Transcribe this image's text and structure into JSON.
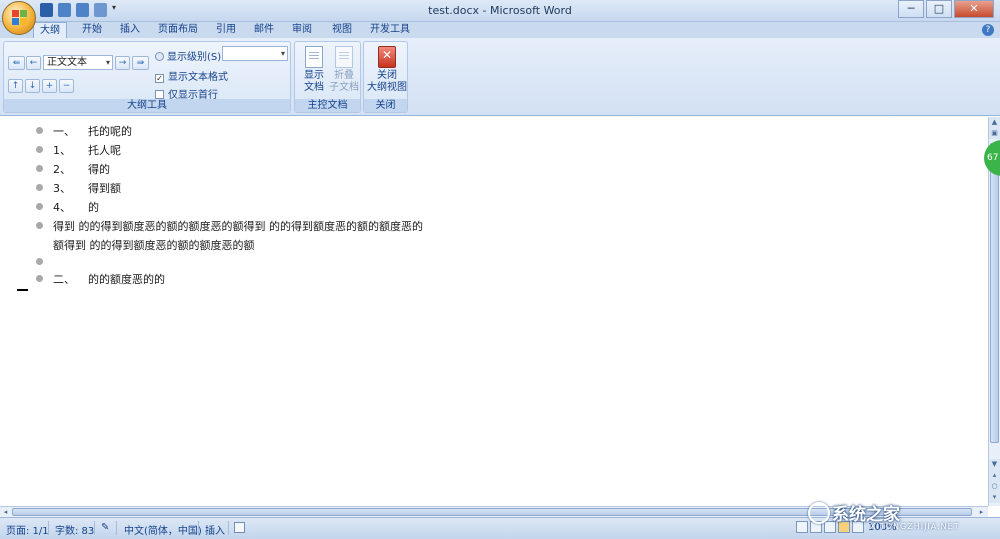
{
  "window": {
    "title": "test.docx - Microsoft Word",
    "minimize": "─",
    "maximize": "□",
    "close": "✕"
  },
  "tabs": [
    {
      "label": "大纲",
      "active": true
    },
    {
      "label": "开始"
    },
    {
      "label": "插入"
    },
    {
      "label": "页面布局"
    },
    {
      "label": "引用"
    },
    {
      "label": "邮件"
    },
    {
      "label": "审阅"
    },
    {
      "label": "视图"
    },
    {
      "label": "开发工具"
    }
  ],
  "ribbon": {
    "outline_tools": {
      "group_label": "大纲工具",
      "level_combo_value": "正文文本",
      "show_level_label": "显示级别(S):",
      "show_level_value": "",
      "show_text_format": {
        "label": "显示文本格式",
        "checked": true
      },
      "show_first_line_only": {
        "label": "仅显示首行",
        "checked": false
      }
    },
    "master_document": {
      "group_label": "主控文档",
      "show_document": "显示\n文档",
      "collapse_subdocs": "折叠\n子文档"
    },
    "close_group": {
      "group_label": "关闭",
      "close_outline_view": "关闭\n大纲视图"
    }
  },
  "document": {
    "lines": [
      {
        "num": "一、",
        "text": "托的呢的",
        "bullet": true
      },
      {
        "num": "1、",
        "text": "托人呢",
        "bullet": true
      },
      {
        "num": "2、",
        "text": "得的",
        "bullet": true
      },
      {
        "num": "3、",
        "text": "得到额",
        "bullet": true
      },
      {
        "num": "4、",
        "text": "的",
        "bullet": true
      },
      {
        "num": "",
        "text": "得到 的的得到额度恶的额的额度恶的额得到 的的得到额度恶的额的额度恶的",
        "bullet": true
      },
      {
        "num": "",
        "text": "额得到 的的得到额度恶的额的额度恶的额",
        "bullet": false
      },
      {
        "num": "",
        "text": "",
        "bullet": true
      },
      {
        "num": "二、",
        "text": "的的额度恶的的",
        "bullet": true
      }
    ]
  },
  "side_badge": "67",
  "statusbar": {
    "page": "页面: 1/1",
    "words": "字数: 83",
    "language": "中文(简体，中国)",
    "insert_mode": "插入",
    "zoom": "100%"
  },
  "watermark": {
    "text": "系统之家",
    "sub": "XITONGZHIJIA.NET"
  }
}
